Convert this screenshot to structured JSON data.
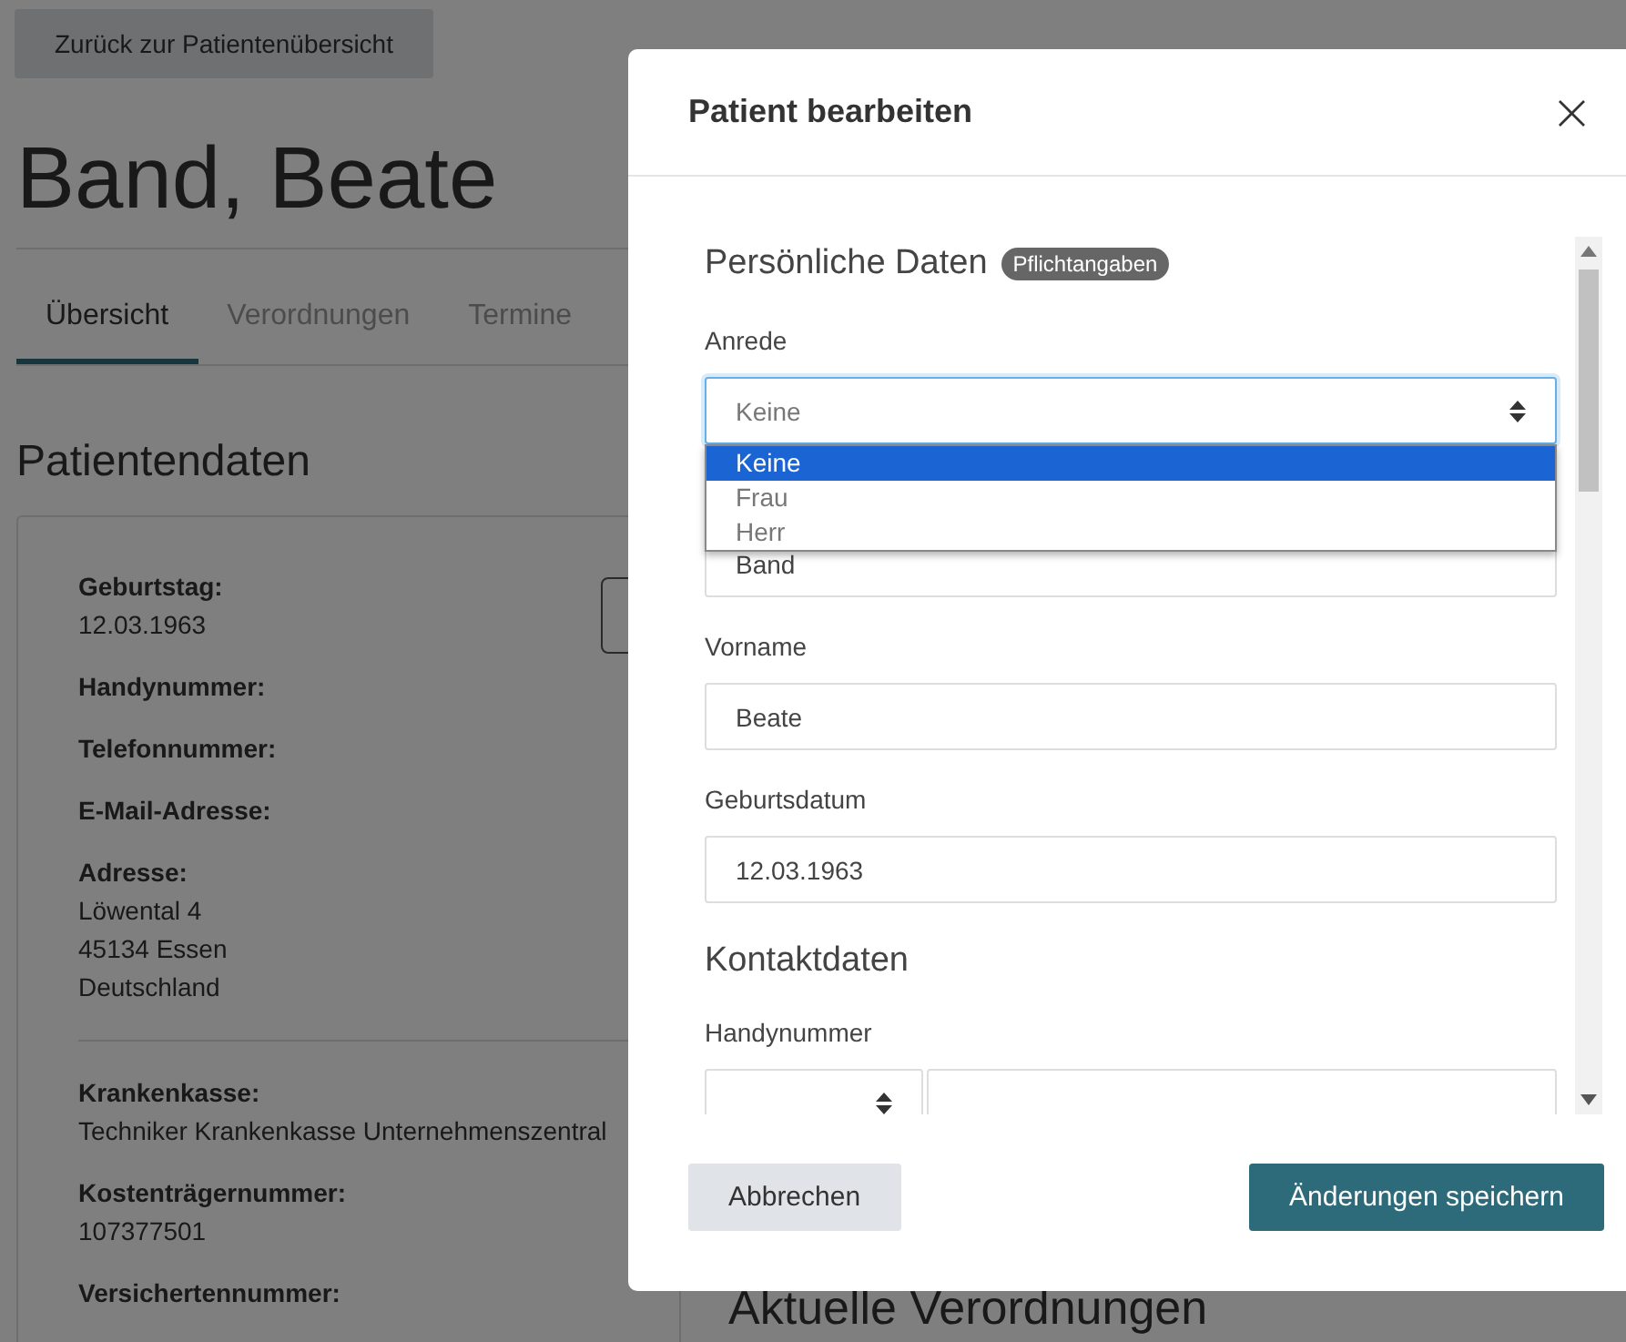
{
  "page": {
    "back_button": "Zurück zur Patientenübersicht",
    "title": "Band, Beate",
    "tabs": [
      {
        "label": "Übersicht",
        "selected": true
      },
      {
        "label": "Verordnungen",
        "selected": false
      },
      {
        "label": "Termine",
        "selected": false
      }
    ],
    "section_title": "Patientendaten",
    "details": [
      {
        "label": "Geburtstag:",
        "lines": [
          "12.03.1963"
        ]
      },
      {
        "label": "Handynummer:"
      },
      {
        "label": "Telefonnummer:"
      },
      {
        "label": "E-Mail-Adresse:"
      },
      {
        "label": "Adresse:",
        "lines": [
          "Löwental 4",
          "45134 Essen",
          "Deutschland"
        ]
      }
    ],
    "insurance": [
      {
        "label": "Krankenkasse:",
        "lines": [
          "Techniker Krankenkasse Unternehmenszentral"
        ]
      },
      {
        "label": "Kostenträgernummer:",
        "lines": [
          "107377501"
        ]
      },
      {
        "label": "Versichertennummer:"
      }
    ],
    "side_title": "Aktuelle Verordnungen"
  },
  "dialog": {
    "title": "Patient bearbeiten",
    "close": "×",
    "sections": [
      {
        "title": "Persönliche Daten",
        "badge": "Pflichtangaben",
        "fields": [
          {
            "kind": "select",
            "label": "Anrede",
            "value": "Keine",
            "expanded": true,
            "options": [
              {
                "label": "Keine",
                "selected": true
              },
              {
                "label": "Frau",
                "selected": false
              },
              {
                "label": "Herr",
                "selected": false
              }
            ]
          },
          {
            "kind": "text",
            "value": "Band"
          },
          {
            "kind": "text",
            "label": "Vorname",
            "value": "Beate"
          },
          {
            "kind": "text",
            "label": "Geburtsdatum",
            "value": "12.03.1963"
          }
        ]
      },
      {
        "title": "Kontaktdaten",
        "fields": [
          {
            "kind": "phone",
            "label": "Handynummer"
          }
        ]
      }
    ],
    "buttons": [
      {
        "label": "Abbrechen",
        "kind": "secondary"
      },
      {
        "label": "Änderungen speichern",
        "kind": "primary"
      }
    ]
  }
}
